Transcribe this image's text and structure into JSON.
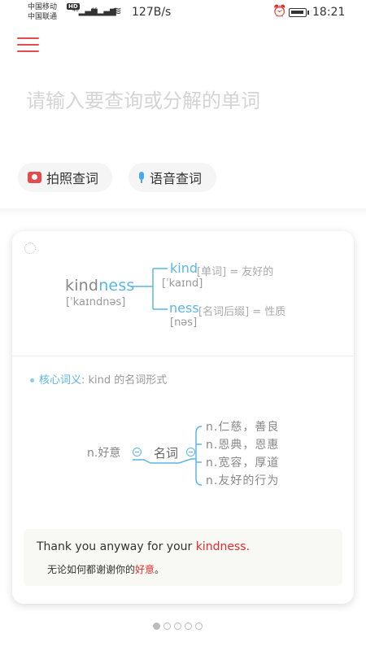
{
  "status_bar": {
    "carrier1": "中国移动",
    "carrier2": "中国联通",
    "hd": "HD",
    "net1": "46",
    "net2": "46",
    "speed": "127B/s",
    "time": "18:21"
  },
  "search": {
    "placeholder": "请输入要查询或分解的单词"
  },
  "buttons": {
    "photo_label": "拍照查词",
    "voice_label": "语音查词"
  },
  "card": {
    "word_root": "kind",
    "word_suffix": "ness",
    "word_phonetic": "[ˈkaɪndnəs]",
    "morphemes": [
      {
        "word": "kind",
        "meta": "[单词] = 友好的",
        "phonetic": "[ˈkaɪnd]"
      },
      {
        "word": "ness",
        "meta": "[名词后缀] = 性质",
        "phonetic": "[nəs]"
      }
    ],
    "core_label": "核心词义",
    "core_text": ": kind 的名词形式",
    "mindmap": {
      "left": "n.好意",
      "center": "名词",
      "items": [
        "n.仁慈，善良",
        "n.恩典，恩惠",
        "n.宽容，厚道",
        "n.友好的行为"
      ]
    },
    "example": {
      "en_before": "Thank you anyway for your ",
      "en_highlight": "kindness",
      "en_after": ".",
      "cn_before": "无论如何都谢谢你的",
      "cn_highlight": "好意",
      "cn_after": "。"
    }
  },
  "pager": {
    "count": 5,
    "active": 1
  },
  "colors": {
    "accent_red": "#e54b4b",
    "accent_blue": "#5bb6e8",
    "highlight": "#e02d2d"
  }
}
